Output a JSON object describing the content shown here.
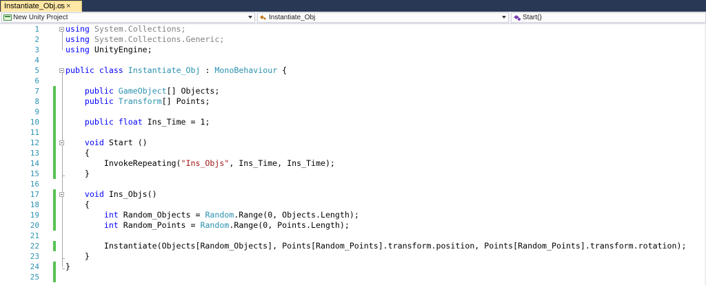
{
  "tab": {
    "title": "Instantiate_Obj.cs",
    "pin_glyph": "⊣",
    "close_glyph": "×"
  },
  "nav": {
    "project": {
      "label": "New Unity Project",
      "icon": "csharp-project-icon"
    },
    "class": {
      "label": "Instantiate_Obj",
      "icon": "class-icon"
    },
    "member": {
      "label": "Start()",
      "icon": "method-icon"
    }
  },
  "colors": {
    "keyword": "#0000ff",
    "type": "#2b91af",
    "string": "#a31515",
    "comment_gray": "#808080",
    "change_bar": "#57c254",
    "line_number": "#2b91af"
  },
  "lines": [
    {
      "n": "1",
      "segs": [
        [
          "kw",
          "using"
        ],
        [
          "gr",
          " System.Collections;"
        ]
      ]
    },
    {
      "n": "2",
      "segs": [
        [
          "kw",
          "using"
        ],
        [
          "gr",
          " System.Collections.Generic;"
        ]
      ]
    },
    {
      "n": "3",
      "segs": [
        [
          "kw",
          "using"
        ],
        [
          "",
          " UnityEngine;"
        ]
      ]
    },
    {
      "n": "4",
      "segs": []
    },
    {
      "n": "5",
      "segs": [
        [
          "kw",
          "public"
        ],
        [
          "",
          " "
        ],
        [
          "kw",
          "class"
        ],
        [
          "",
          " "
        ],
        [
          "ty",
          "Instantiate_Obj"
        ],
        [
          "",
          " : "
        ],
        [
          "ty",
          "MonoBehaviour"
        ],
        [
          "",
          " {"
        ]
      ]
    },
    {
      "n": "6",
      "segs": []
    },
    {
      "n": "7",
      "segs": [
        [
          "",
          "    "
        ],
        [
          "kw",
          "public"
        ],
        [
          "",
          " "
        ],
        [
          "ty",
          "GameObject"
        ],
        [
          "",
          "[] Objects;"
        ]
      ]
    },
    {
      "n": "8",
      "segs": [
        [
          "",
          "    "
        ],
        [
          "kw",
          "public"
        ],
        [
          "",
          " "
        ],
        [
          "ty",
          "Transform"
        ],
        [
          "",
          "[] Points;"
        ]
      ]
    },
    {
      "n": "9",
      "segs": []
    },
    {
      "n": "10",
      "segs": [
        [
          "",
          "    "
        ],
        [
          "kw",
          "public"
        ],
        [
          "",
          " "
        ],
        [
          "kw",
          "float"
        ],
        [
          "",
          " Ins_Time = 1;"
        ]
      ]
    },
    {
      "n": "11",
      "segs": []
    },
    {
      "n": "12",
      "segs": [
        [
          "",
          "    "
        ],
        [
          "kw",
          "void"
        ],
        [
          "",
          " Start ()"
        ]
      ]
    },
    {
      "n": "13",
      "segs": [
        [
          "",
          "    {"
        ]
      ]
    },
    {
      "n": "14",
      "segs": [
        [
          "",
          "        InvokeRepeating("
        ],
        [
          "st",
          "\"Ins_Objs\""
        ],
        [
          "",
          ", Ins_Time, Ins_Time);"
        ]
      ]
    },
    {
      "n": "15",
      "segs": [
        [
          "",
          "    }"
        ]
      ]
    },
    {
      "n": "16",
      "segs": []
    },
    {
      "n": "17",
      "segs": [
        [
          "",
          "    "
        ],
        [
          "kw",
          "void"
        ],
        [
          "",
          " Ins_Objs()"
        ]
      ]
    },
    {
      "n": "18",
      "segs": [
        [
          "",
          "    {"
        ]
      ]
    },
    {
      "n": "19",
      "segs": [
        [
          "",
          "        "
        ],
        [
          "kw",
          "int"
        ],
        [
          "",
          " Random_Objects = "
        ],
        [
          "ty",
          "Random"
        ],
        [
          "",
          ".Range(0, Objects.Length);"
        ]
      ]
    },
    {
      "n": "20",
      "segs": [
        [
          "",
          "        "
        ],
        [
          "kw",
          "int"
        ],
        [
          "",
          " Random_Points = "
        ],
        [
          "ty",
          "Random"
        ],
        [
          "",
          ".Range(0, Points.Length);"
        ]
      ]
    },
    {
      "n": "21",
      "segs": []
    },
    {
      "n": "22",
      "segs": [
        [
          "",
          "        Instantiate(Objects[Random_Objects], Points[Random_Points].transform.position, Points[Random_Points].transform.rotation);"
        ]
      ]
    },
    {
      "n": "23",
      "segs": [
        [
          "",
          "    }"
        ]
      ]
    },
    {
      "n": "24",
      "segs": [
        [
          "",
          "}"
        ]
      ]
    },
    {
      "n": "25",
      "segs": []
    }
  ]
}
